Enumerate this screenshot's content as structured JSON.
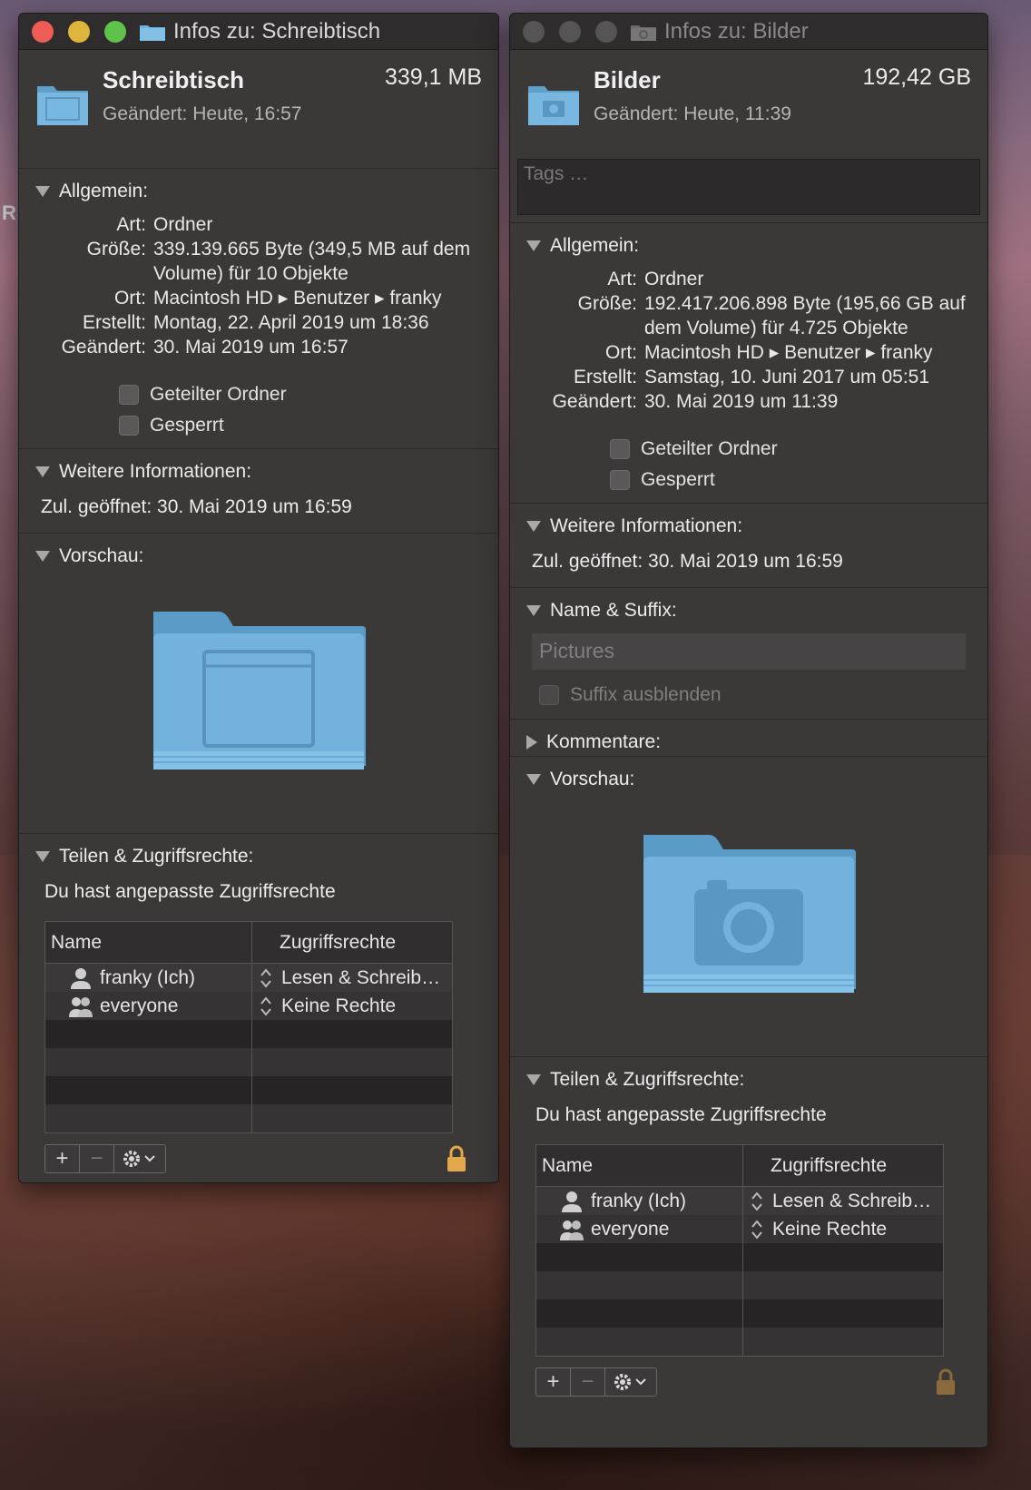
{
  "desktop": {
    "edge_letter": "R"
  },
  "win1": {
    "title": "Infos zu: Schreibtisch",
    "name": "Schreibtisch",
    "size": "339,1 MB",
    "modified_short": "Geändert: Heute, 16:57",
    "general_title": "Allgemein:",
    "general": [
      {
        "k": "Art:",
        "v": "Ordner"
      },
      {
        "k": "Größe:",
        "v": "339.139.665 Byte (349,5 MB auf dem Volume) für 10 Objekte"
      },
      {
        "k": "Ort:",
        "v": "Macintosh HD ▸ Benutzer ▸ franky"
      },
      {
        "k": "Erstellt:",
        "v": "Montag, 22. April 2019 um 18:36"
      },
      {
        "k": "Geändert:",
        "v": "30. Mai 2019 um 16:57"
      }
    ],
    "shared_folder": "Geteilter Ordner",
    "locked": "Gesperrt",
    "more_title": "Weitere Informationen:",
    "last_opened": "Zul. geöffnet: 30. Mai 2019 um 16:59",
    "preview_title": "Vorschau:",
    "perm_title": "Teilen & Zugriffsrechte:",
    "perm_text": "Du hast angepasste Zugriffsrechte",
    "col_name": "Name",
    "col_rights": "Zugriffsrechte",
    "rows": [
      {
        "name": "franky (Ich)",
        "rights": "Lesen & Schreib…"
      },
      {
        "name": "everyone",
        "rights": "Keine Rechte"
      }
    ]
  },
  "win2": {
    "title": "Infos zu: Bilder",
    "name": "Bilder",
    "size": "192,42 GB",
    "modified_short": "Geändert: Heute, 11:39",
    "tags_placeholder": "Tags …",
    "general_title": "Allgemein:",
    "general": [
      {
        "k": "Art:",
        "v": "Ordner"
      },
      {
        "k": "Größe:",
        "v": "192.417.206.898 Byte (195,66 GB auf dem Volume) für 4.725 Objekte"
      },
      {
        "k": "Ort:",
        "v": "Macintosh HD ▸ Benutzer ▸ franky"
      },
      {
        "k": "Erstellt:",
        "v": "Samstag, 10. Juni 2017 um 05:51"
      },
      {
        "k": "Geändert:",
        "v": "30. Mai 2019 um 11:39"
      }
    ],
    "shared_folder": "Geteilter Ordner",
    "locked": "Gesperrt",
    "more_title": "Weitere Informationen:",
    "last_opened": "Zul. geöffnet: 30. Mai 2019 um 16:59",
    "name_suffix_title": "Name & Suffix:",
    "name_field": "Pictures",
    "hide_suffix": "Suffix ausblenden",
    "comments_title": "Kommentare:",
    "preview_title": "Vorschau:",
    "perm_title": "Teilen & Zugriffsrechte:",
    "perm_text": "Du hast angepasste Zugriffsrechte",
    "col_name": "Name",
    "col_rights": "Zugriffsrechte",
    "rows": [
      {
        "name": "franky (Ich)",
        "rights": "Lesen & Schreib…"
      },
      {
        "name": "everyone",
        "rights": "Keine Rechte"
      }
    ]
  },
  "colors": {
    "folder_blue": "#6fb1dc",
    "window_bg": "#3b3838",
    "lock": "#e2a84a"
  }
}
